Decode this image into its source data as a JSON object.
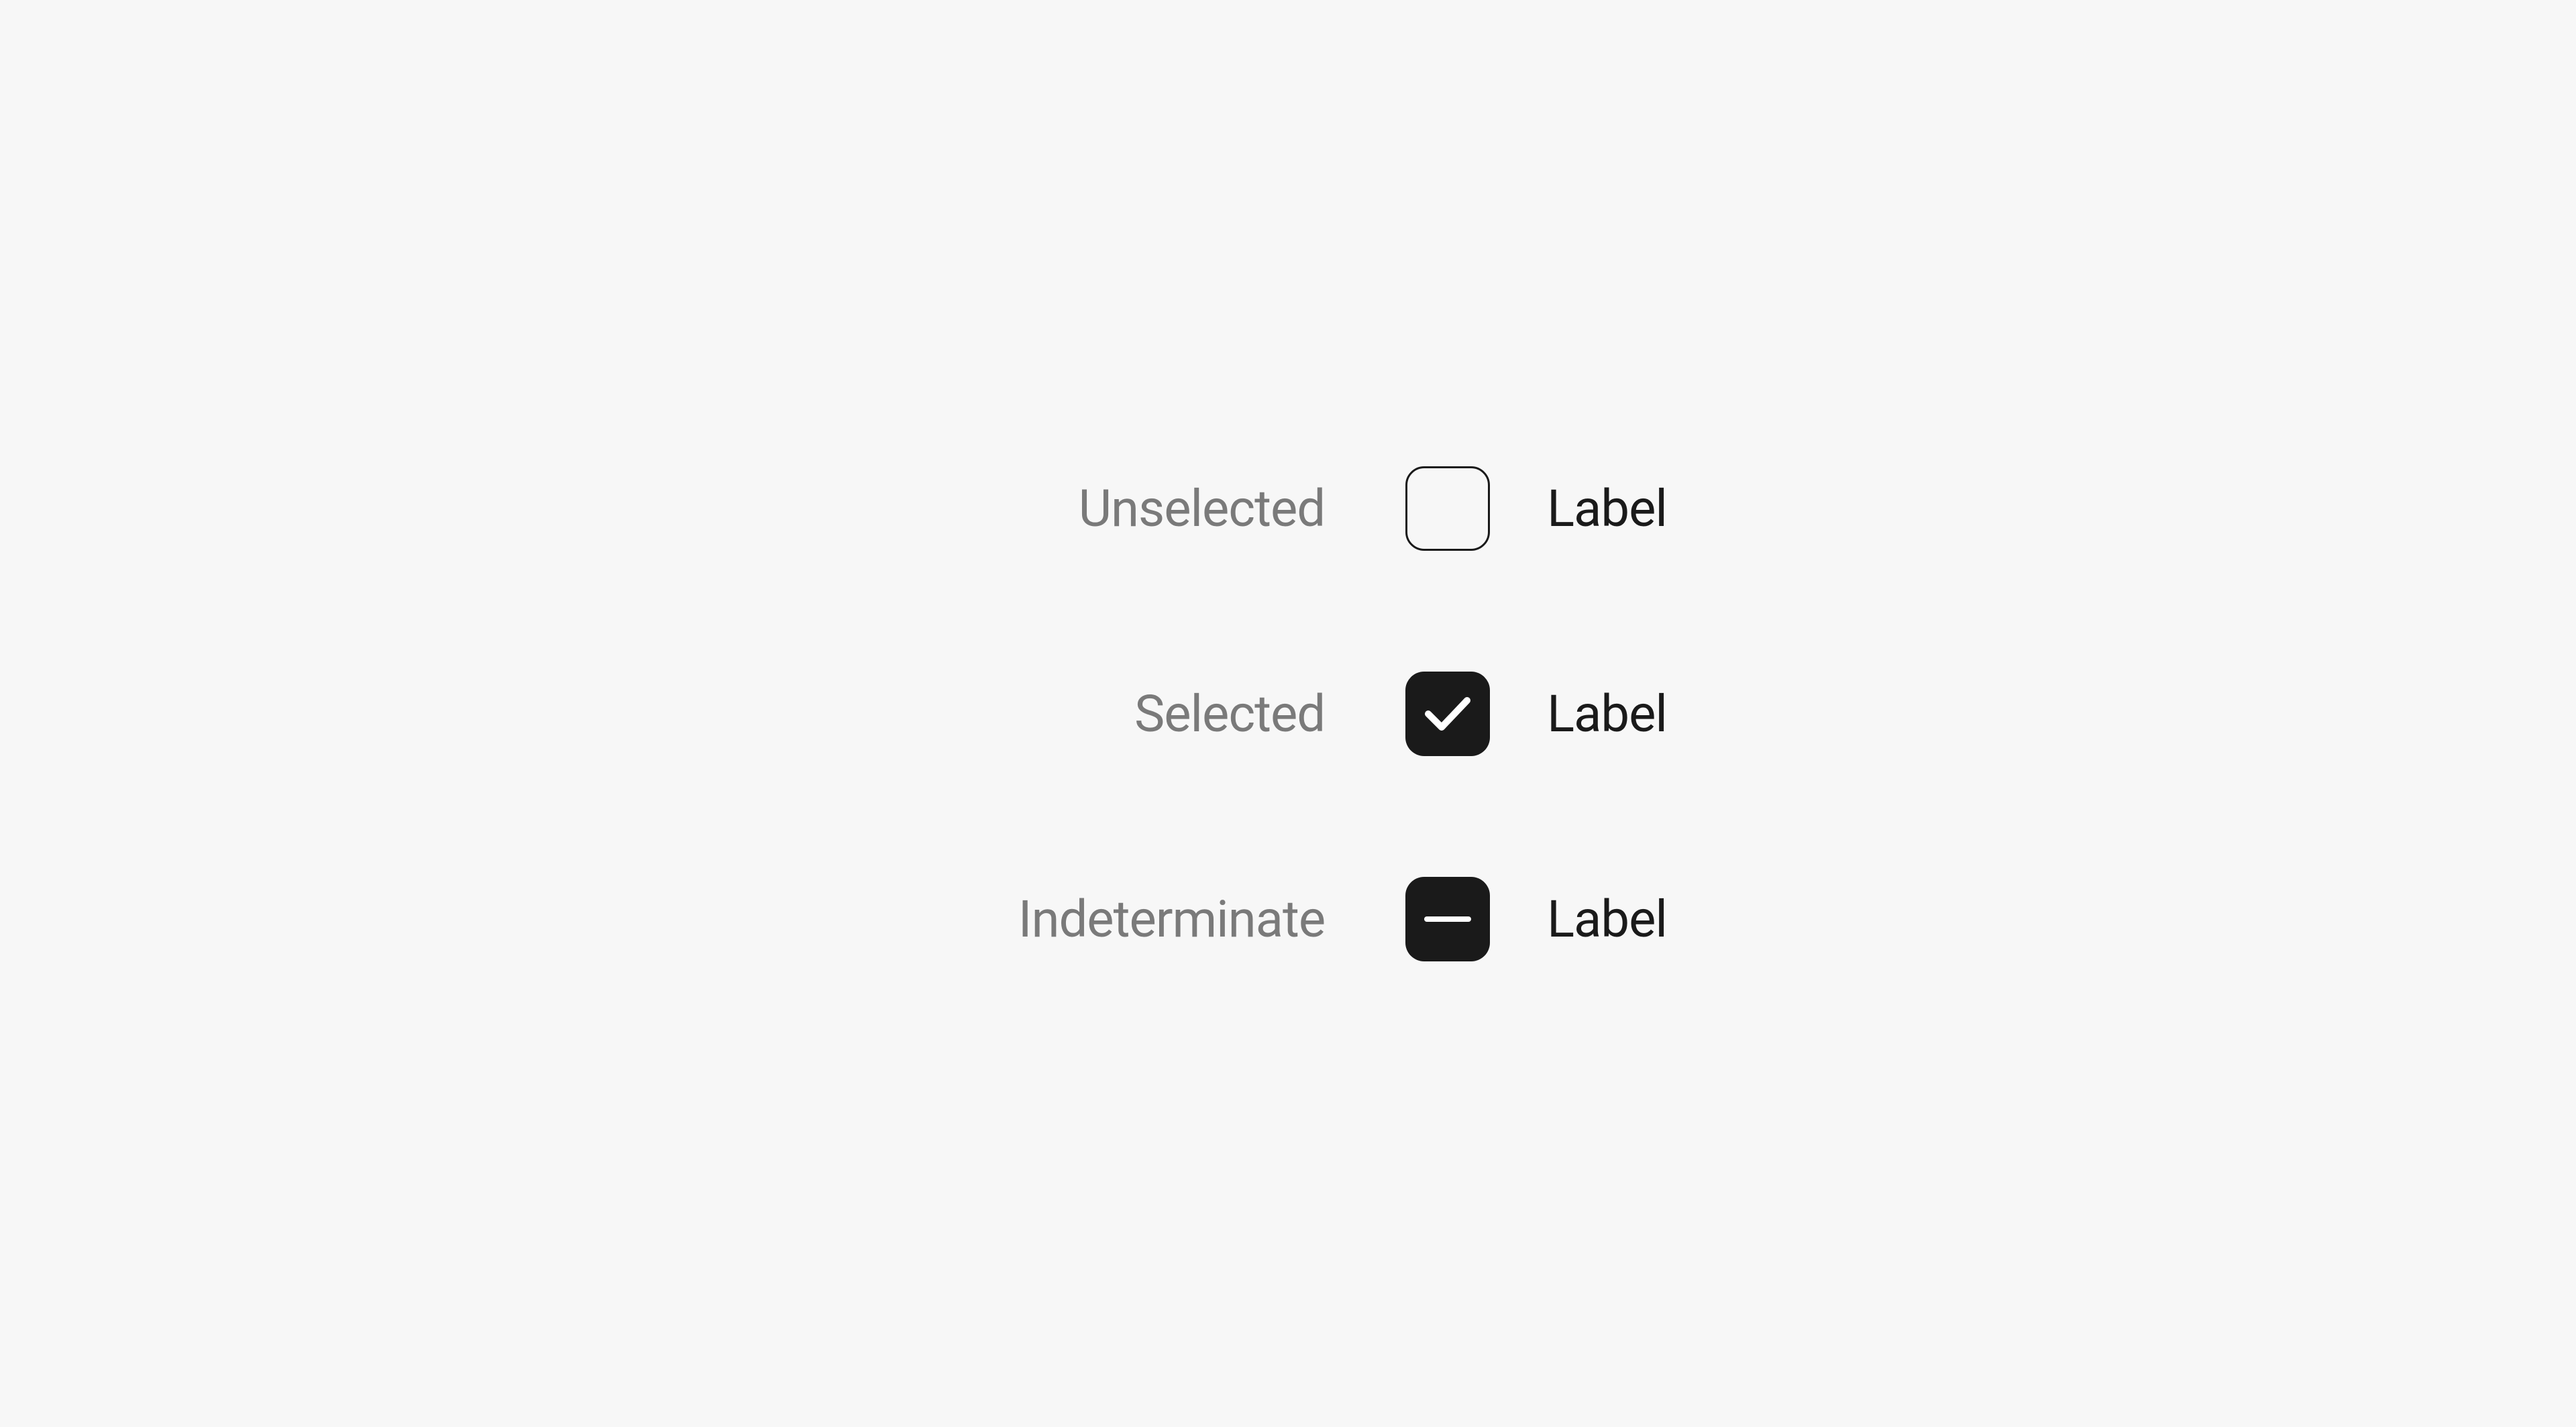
{
  "states": [
    {
      "stateLabel": "Unselected",
      "checkboxLabel": "Label",
      "type": "unselected"
    },
    {
      "stateLabel": "Selected",
      "checkboxLabel": "Label",
      "type": "selected"
    },
    {
      "stateLabel": "Indeterminate",
      "checkboxLabel": "Label",
      "type": "indeterminate"
    }
  ],
  "colors": {
    "background": "#f7f7f7",
    "stateText": "#7a7a7a",
    "labelText": "#1a1a1a",
    "checkboxFill": "#1a1a1a",
    "checkboxBorder": "#1a1a1a",
    "iconColor": "#ffffff"
  }
}
